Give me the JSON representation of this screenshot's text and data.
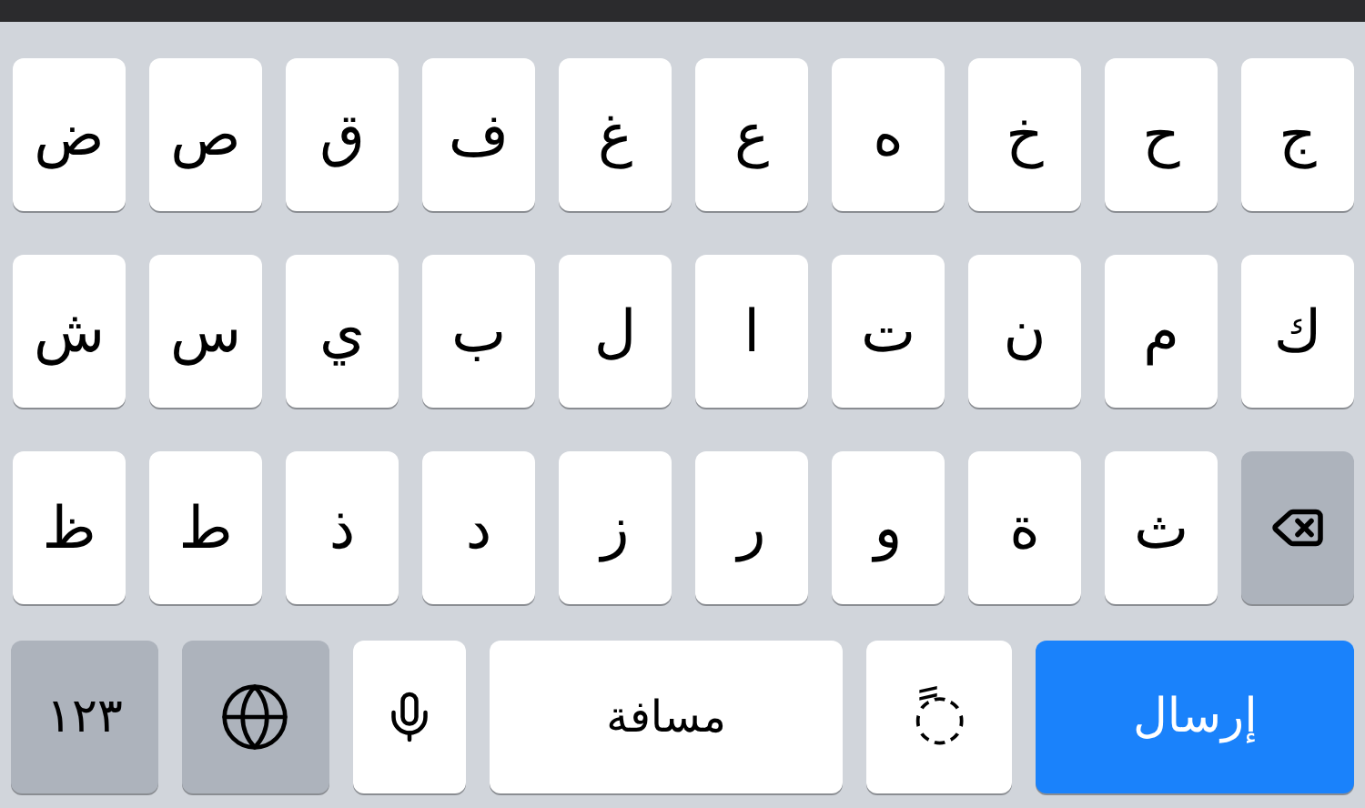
{
  "keyboard": {
    "rows": [
      {
        "keys": [
          {
            "kind": "char",
            "label": "ج"
          },
          {
            "kind": "char",
            "label": "ح"
          },
          {
            "kind": "char",
            "label": "خ"
          },
          {
            "kind": "char",
            "label": "ه"
          },
          {
            "kind": "char",
            "label": "ع"
          },
          {
            "kind": "char",
            "label": "غ"
          },
          {
            "kind": "char",
            "label": "ف"
          },
          {
            "kind": "char",
            "label": "ق"
          },
          {
            "kind": "char",
            "label": "ص"
          },
          {
            "kind": "char",
            "label": "ض"
          }
        ]
      },
      {
        "keys": [
          {
            "kind": "char",
            "label": "ك"
          },
          {
            "kind": "char",
            "label": "م"
          },
          {
            "kind": "char",
            "label": "ن"
          },
          {
            "kind": "char",
            "label": "ت"
          },
          {
            "kind": "char",
            "label": "ا"
          },
          {
            "kind": "char",
            "label": "ل"
          },
          {
            "kind": "char",
            "label": "ب"
          },
          {
            "kind": "char",
            "label": "ي"
          },
          {
            "kind": "char",
            "label": "س"
          },
          {
            "kind": "char",
            "label": "ش"
          }
        ]
      },
      {
        "keys": [
          {
            "kind": "backspace"
          },
          {
            "kind": "char",
            "label": "ث"
          },
          {
            "kind": "char",
            "label": "ة"
          },
          {
            "kind": "char",
            "label": "و"
          },
          {
            "kind": "char",
            "label": "ر"
          },
          {
            "kind": "char",
            "label": "ز"
          },
          {
            "kind": "char",
            "label": "د"
          },
          {
            "kind": "char",
            "label": "ذ"
          },
          {
            "kind": "char",
            "label": "ط"
          },
          {
            "kind": "char",
            "label": "ظ"
          }
        ]
      },
      {
        "keys": [
          {
            "kind": "send",
            "label": "إرسال"
          },
          {
            "kind": "diacritic",
            "label": "◌ً"
          },
          {
            "kind": "space",
            "label": "مسافة"
          },
          {
            "kind": "mic"
          },
          {
            "kind": "globe"
          },
          {
            "kind": "numbers",
            "label": "١٢٣"
          }
        ]
      }
    ]
  }
}
